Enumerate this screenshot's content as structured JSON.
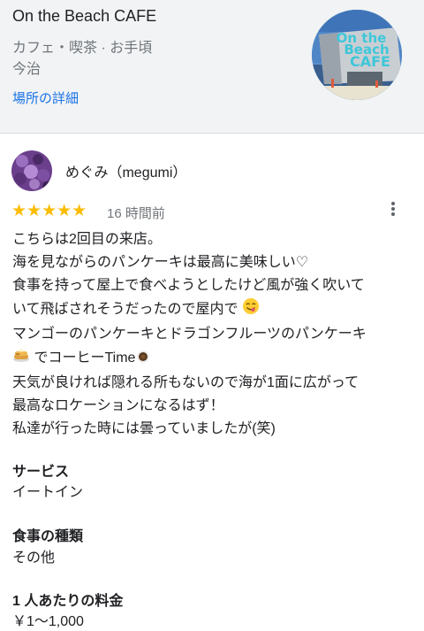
{
  "place": {
    "name": "On the Beach CAFE",
    "category": "カフェ・喫茶 · お手頃",
    "area": "今治",
    "details_link": "場所の詳細"
  },
  "thumbnail_sign": {
    "line1": "On the",
    "line2": "Beach",
    "line3": "CAFE"
  },
  "review": {
    "author": "めぐみ（megumi）",
    "rating": 5,
    "stars": "★★★★★",
    "time": "16 時間前",
    "lines": [
      "こちらは2回目の来店。",
      "海を見ながらのパンケーキは最高に美味しい♡",
      "食事を持って屋上で食べようとしたけど風が強く吹いて",
      "いて飛ばされそうだったので屋内で",
      "マンゴーのパンケーキとドラゴンフルーツのパンケーキ",
      "でコーヒーTime",
      "天気が良ければ隠れる所もないので海が1面に広がって",
      "最高なロケーションになるはず！",
      "私達が行った時には曇っていましたが(笑)"
    ]
  },
  "attributes": {
    "service_label": "サービス",
    "service_value": "イートイン",
    "meal_label": "食事の種類",
    "meal_value": "その他",
    "price_label": "1 人あたりの料金",
    "price_value": "￥1～1,000"
  },
  "colors": {
    "star": "#fbbc04",
    "link": "#1a73e8",
    "muted": "#70757a",
    "header_bg": "#f1f3f4"
  }
}
